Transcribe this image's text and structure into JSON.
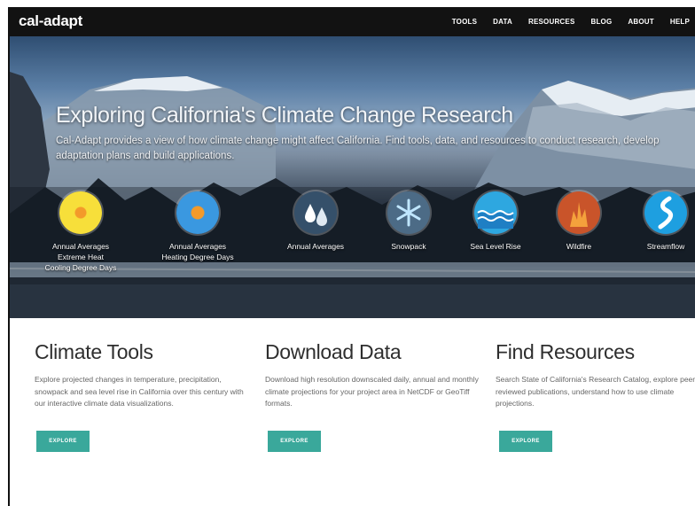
{
  "nav": {
    "logo": "cal-adapt",
    "items": [
      "TOOLS",
      "DATA",
      "RESOURCES",
      "BLOG",
      "ABOUT",
      "HELP"
    ]
  },
  "hero": {
    "title": "Exploring California's Climate Change Research",
    "subtitle": "Cal-Adapt provides a view of how climate change might affect California. Find tools, data, and resources to conduct research, develop adaptation plans and build applications.",
    "tools": [
      {
        "label": "Annual Averages\nExtreme Heat\nCooling Degree Days",
        "icon": "sun-heat-icon",
        "color": "#f3d21e"
      },
      {
        "label": "Annual Averages\nHeating Degree Days",
        "icon": "heating-sun-icon",
        "color": "#2e8fd8"
      },
      {
        "label": "Annual Averages",
        "icon": "water-drops-icon",
        "color": "#3a5670"
      },
      {
        "label": "Snowpack",
        "icon": "snowflake-icon",
        "color": "#4a6a86"
      },
      {
        "label": "Sea Level Rise",
        "icon": "waves-icon",
        "color": "#2ea7e0"
      },
      {
        "label": "Wildfire",
        "icon": "flame-icon",
        "color": "#d4582a"
      },
      {
        "label": "Streamflow",
        "icon": "stream-icon",
        "color": "#1e9fe0"
      }
    ]
  },
  "sections": [
    {
      "title": "Climate Tools",
      "text": "Explore projected changes in temperature, precipitation, snowpack and sea level rise in California over this century with our interactive climate data visualizations.",
      "button": "EXPLORE"
    },
    {
      "title": "Download Data",
      "text": "Download high resolution downscaled daily, annual and monthly climate projections for your project area in NetCDF or GeoTiff formats.",
      "button": "EXPLORE"
    },
    {
      "title": "Find Resources",
      "text": "Search State of California's Research Catalog, explore peer-reviewed publications, understand how to use climate projections.",
      "button": "EXPLORE"
    }
  ],
  "colors": {
    "accent": "#3aa89b",
    "nav_bg": "#121212"
  }
}
